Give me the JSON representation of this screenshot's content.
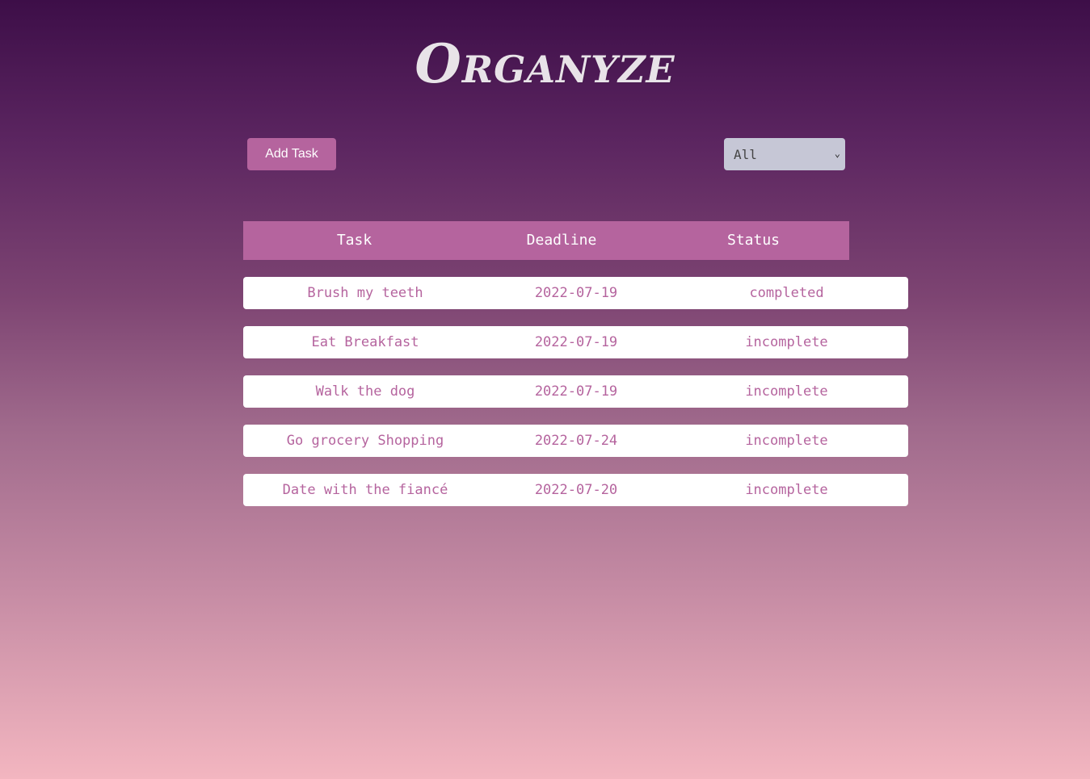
{
  "app": {
    "title": "Organyze"
  },
  "toolbar": {
    "add_label": "Add Task",
    "filter_value": "All"
  },
  "table": {
    "headers": [
      "Task",
      "Deadline",
      "Status"
    ],
    "rows": [
      {
        "task": "Brush my teeth",
        "deadline": "2022-07-19",
        "status": "completed"
      },
      {
        "task": "Eat Breakfast",
        "deadline": "2022-07-19",
        "status": "incomplete"
      },
      {
        "task": "Walk the dog",
        "deadline": "2022-07-19",
        "status": "incomplete"
      },
      {
        "task": "Go grocery Shopping",
        "deadline": "2022-07-24",
        "status": "incomplete"
      },
      {
        "task": "Date with the fiancé",
        "deadline": "2022-07-20",
        "status": "incomplete"
      }
    ]
  },
  "colors": {
    "accent": "#b5649e",
    "title_text": "#e8e3e8",
    "select_bg": "#c6c7d6",
    "row_bg": "#ffffff"
  },
  "icons": {
    "filter_dropdown": "chevron-down-icon"
  }
}
